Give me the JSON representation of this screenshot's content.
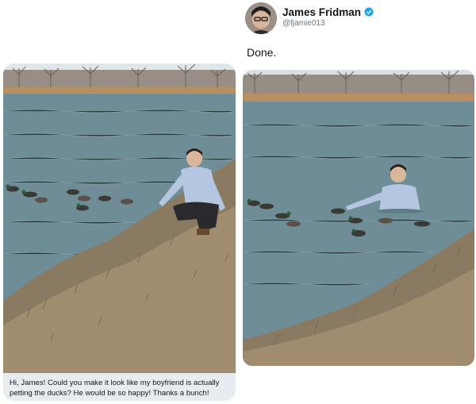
{
  "request": {
    "text_line1": "Hi, James! Could you make it look like my boyfriend is actually",
    "text_line2": "petting the ducks? He would be so happy! Thanks a bunch!",
    "photo": "original-photo-man-crouching-by-pond-with-ducks"
  },
  "response": {
    "display_name": "James Fridman",
    "handle": "@fjamie013",
    "verified_icon": "verified-badge-icon",
    "reply_text": "Done.",
    "photo": "edited-photo-man-in-pond-with-ducks"
  },
  "colors": {
    "text": "#14171a",
    "secondary_text": "#657786",
    "bubble_bg": "#e6ecf0",
    "verified_blue": "#1da1f2"
  }
}
